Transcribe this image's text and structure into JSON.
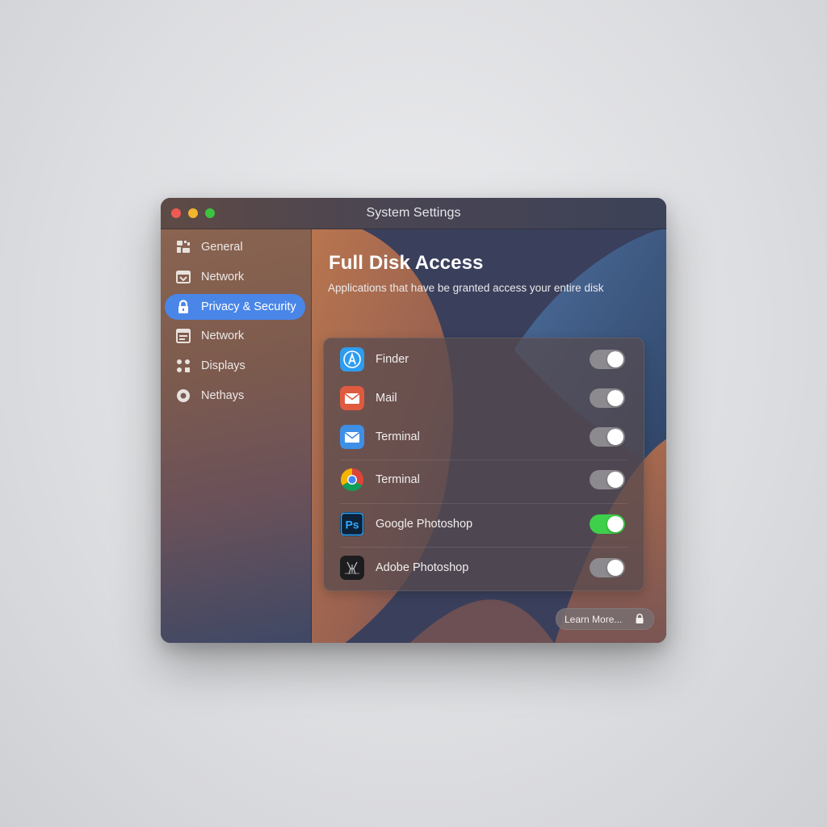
{
  "window": {
    "title": "System Settings"
  },
  "sidebar": {
    "items": [
      {
        "label": "General",
        "icon": "general-icon"
      },
      {
        "label": "Network",
        "icon": "network-icon"
      },
      {
        "label": "Privacy & Security",
        "icon": "lock-icon",
        "active": true
      },
      {
        "label": "Network",
        "icon": "network-alt-icon"
      },
      {
        "label": "Displays",
        "icon": "displays-icon"
      },
      {
        "label": "Nethays",
        "icon": "circle-icon"
      }
    ]
  },
  "main": {
    "title": "Full Disk Access",
    "subtitle": "Applications that have be granted access your entire disk",
    "apps": [
      {
        "name": "Finder",
        "icon": "app-store-icon",
        "enabled": false
      },
      {
        "name": "Mail",
        "icon": "mail-icon",
        "enabled": false
      },
      {
        "name": "Terminal",
        "icon": "mail-blue-icon",
        "enabled": false
      },
      {
        "name": "Terminal",
        "icon": "chrome-icon",
        "enabled": false
      },
      {
        "name": "Google Photoshop",
        "icon": "photoshop-icon",
        "enabled": true
      },
      {
        "name": "Adobe Photoshop",
        "icon": "dark-app-icon",
        "enabled": false
      }
    ],
    "learn_more_label": "Learn More...",
    "learn_more_icon": "lock-icon"
  },
  "colors": {
    "accent": "#4a86e8",
    "toggle_on": "#3ed04a",
    "toggle_off": "#8d8a8f"
  }
}
